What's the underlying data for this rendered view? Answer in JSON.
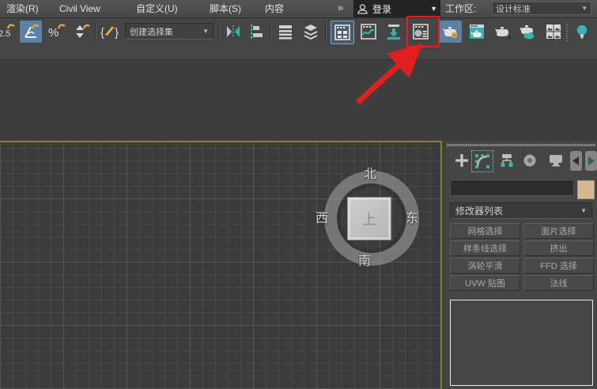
{
  "menubar": {
    "items": [
      {
        "label": "渲染(R)"
      },
      {
        "label": "Civil View"
      },
      {
        "label": "自定义(U)"
      },
      {
        "label": "脚本(S)"
      },
      {
        "label": "内容"
      }
    ],
    "overflow_chevron": "»",
    "signin": {
      "label": "登录"
    },
    "workspace_label": "工作区:",
    "workspace_value": "设计标准"
  },
  "toolbar": {
    "selection_set_value": "创建选择集",
    "snap_text": "2.5",
    "percent_text": "%",
    "buttons": [
      "snap-toggle-2.5",
      "angle-snap-toggle",
      "percent-snap-toggle",
      "spinner-snap-toggle",
      "edit-named-selection-sets",
      "named-selection-set-dropdown",
      "mirror",
      "align",
      "toggle-layer-explorer",
      "toggle-scene-explorer",
      "toggle-ribbon",
      "curve-editor",
      "schematic-view",
      "material-editor",
      "render-setup",
      "rendered-frame-window",
      "render-production",
      "render-in-cloud",
      "a360-gallery",
      "default-lights"
    ]
  },
  "annotation": {
    "highlight_color": "#e01f1f",
    "highlighted_button": "material-editor"
  },
  "viewport": {
    "compass": {
      "north": "北",
      "south": "南",
      "west": "西",
      "east": "东",
      "cube_top": "上"
    }
  },
  "panel": {
    "tabs": [
      "create",
      "modify",
      "hierarchy",
      "motion",
      "display"
    ],
    "selected_tab": "modify",
    "object_name_value": "",
    "modifier_list_label": "修改器列表",
    "modifier_buttons": [
      "网格选择",
      "面片选择",
      "样条线选择",
      "挤出",
      "涡轮平滑",
      "FFD 选择",
      "UVW 贴图",
      "法线"
    ]
  },
  "icons": {
    "dropdown_arrow": "▼",
    "left_arrow": "◄",
    "right_arrow": "►"
  },
  "colors": {
    "accent_teal": "#35b3ae",
    "accent_orange": "#e8a33d",
    "active_blue": "#5d81a5",
    "viewport_border": "#8d7d33",
    "object_color_swatch": "#d6b88c"
  }
}
